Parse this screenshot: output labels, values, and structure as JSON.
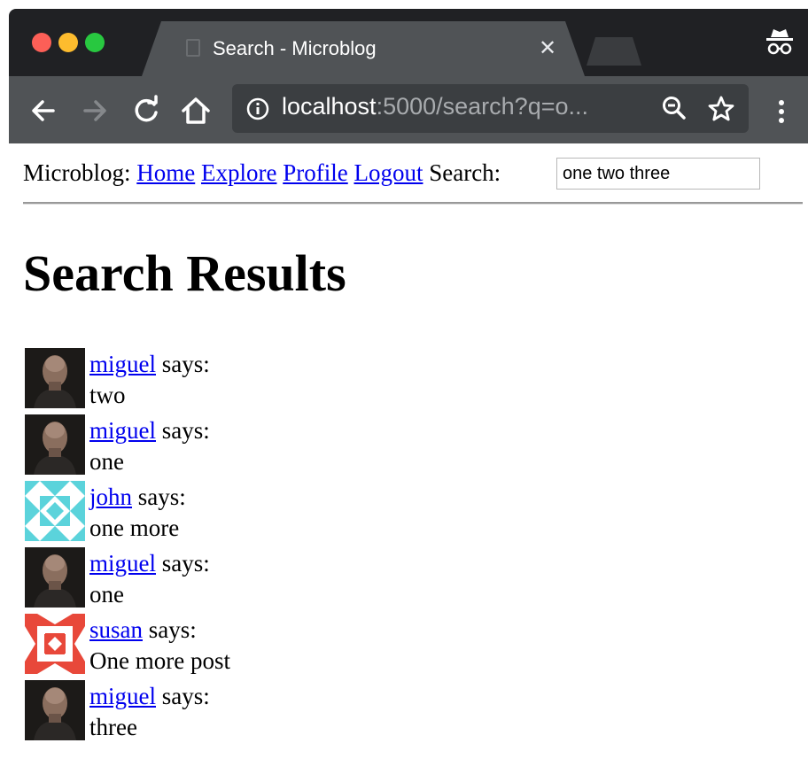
{
  "browser": {
    "tab_title": "Search - Microblog",
    "tab_close": "✕",
    "url_host": "localhost",
    "url_rest": ":5000/search?q=o...",
    "colors": {
      "titlebar": "#202124",
      "toolbar": "#505356",
      "omnibox": "#3b3e41"
    }
  },
  "nav": {
    "brand": "Microblog:",
    "links": [
      "Home",
      "Explore",
      "Profile",
      "Logout"
    ],
    "search_label": "Search:",
    "search_value": "one two three"
  },
  "main": {
    "heading": "Search Results",
    "says_text": "says:",
    "posts": [
      {
        "author": "miguel",
        "avatar": "miguel-photo-avatar",
        "body": "two"
      },
      {
        "author": "miguel",
        "avatar": "miguel-photo-avatar",
        "body": "one"
      },
      {
        "author": "john",
        "avatar": "cyan-identicon-avatar",
        "body": "one more"
      },
      {
        "author": "miguel",
        "avatar": "miguel-photo-avatar",
        "body": "one"
      },
      {
        "author": "susan",
        "avatar": "red-identicon-avatar",
        "body": "One more post"
      },
      {
        "author": "miguel",
        "avatar": "miguel-photo-avatar",
        "body": "three"
      }
    ]
  },
  "colors": {
    "link": "#0000ee",
    "john_identicon": "#5bd3db",
    "susan_identicon": "#e8483a"
  }
}
